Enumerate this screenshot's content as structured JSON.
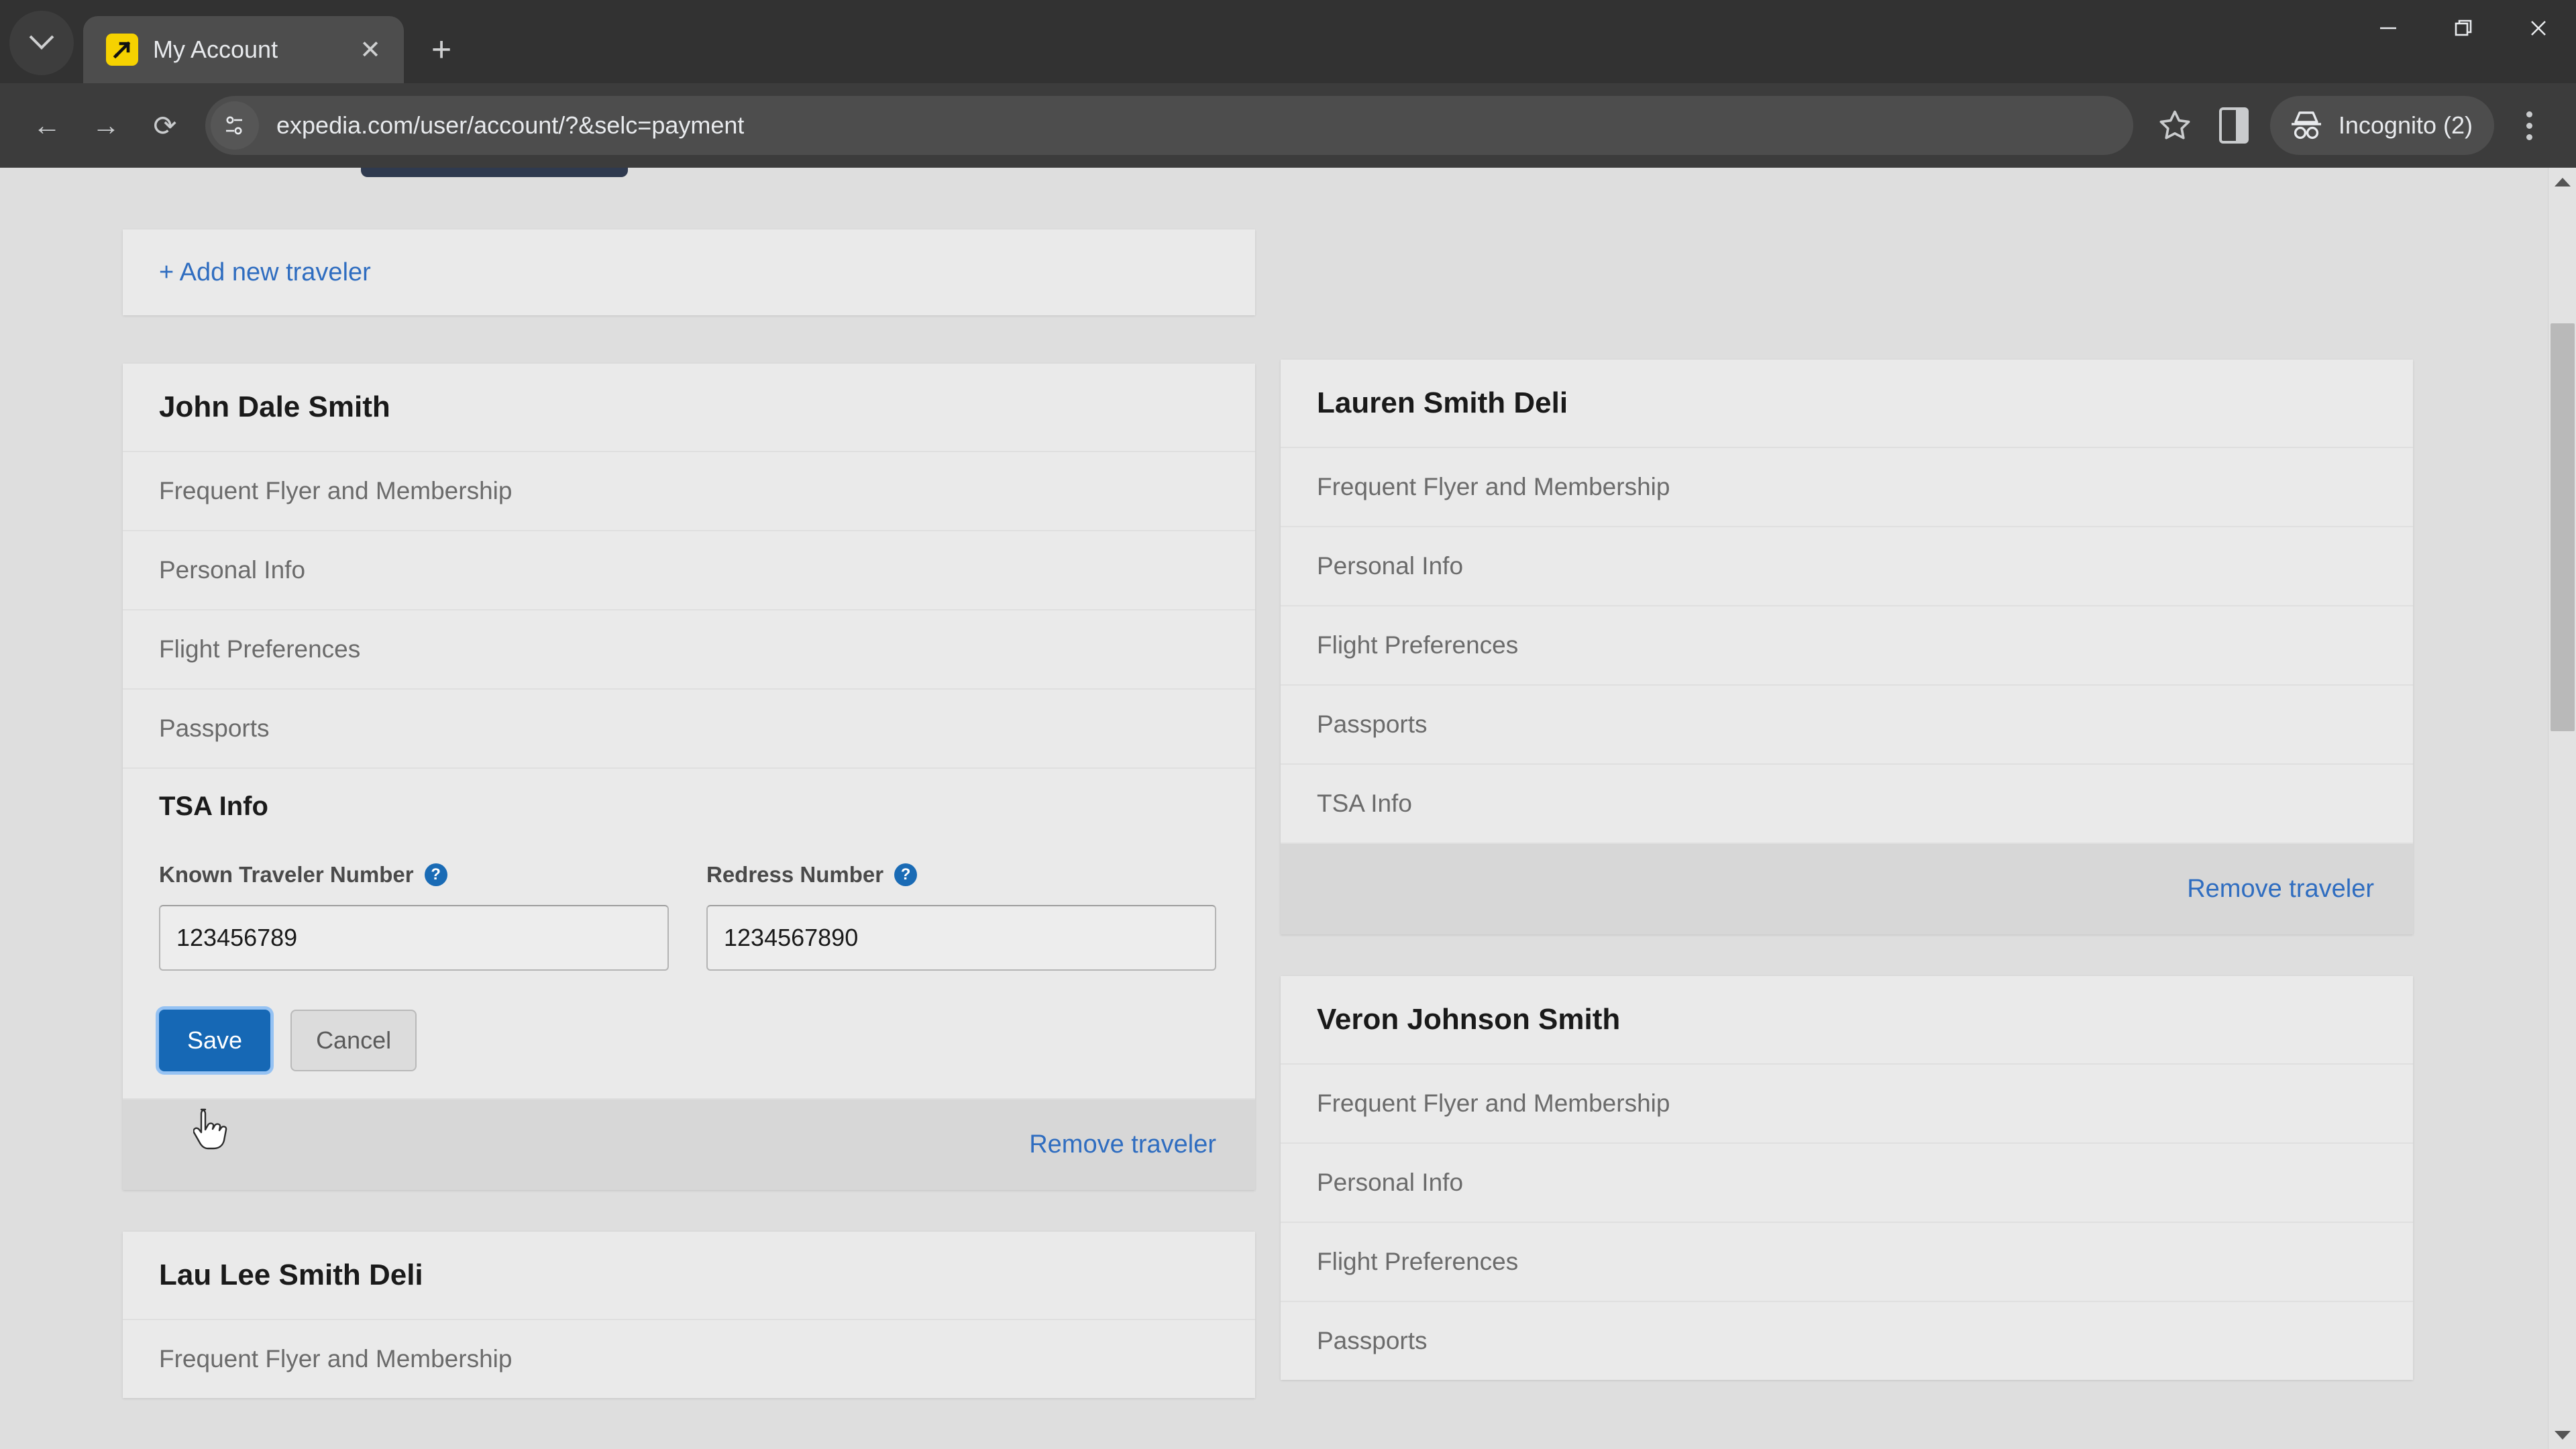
{
  "browser": {
    "tab_search_icon": "chevron-down-icon",
    "tab": {
      "title": "My Account",
      "favicon": "expedia-favicon",
      "close_label": "✕"
    },
    "new_tab_label": "+",
    "window_controls": {
      "minimize": "—",
      "restore": "restore",
      "close": "✕"
    },
    "nav": {
      "back": "←",
      "forward": "→",
      "reload": "⟳"
    },
    "omnibox": {
      "site_info_icon": "site-settings-icon",
      "url": "expedia.com/user/account/?&selc=payment"
    },
    "bookmark_icon": "star-icon",
    "side_panel_icon": "side-panel-icon",
    "incognito": {
      "icon": "incognito-icon",
      "label": "Incognito (2)"
    },
    "menu_icon": "kebab-menu-icon"
  },
  "page": {
    "add_traveler_label": "+ Add new traveler",
    "remove_traveler_label": "Remove traveler",
    "section_rows": [
      "Frequent Flyer and Membership",
      "Personal Info",
      "Flight Preferences",
      "Passports",
      "TSA Info"
    ],
    "left_column": {
      "traveler_1": {
        "name": "John Dale Smith",
        "rows": [
          "Frequent Flyer and Membership",
          "Personal Info",
          "Flight Preferences",
          "Passports"
        ],
        "tsa": {
          "title": "TSA Info",
          "known_traveler": {
            "label": "Known Traveler Number",
            "help_icon": "?",
            "value": "123456789",
            "placeholder": ""
          },
          "redress": {
            "label": "Redress Number",
            "help_icon": "?",
            "value": "1234567890",
            "placeholder": ""
          },
          "save_label": "Save",
          "cancel_label": "Cancel"
        },
        "remove_label": "Remove traveler"
      },
      "traveler_2": {
        "name": "Lau Lee Smith Deli"
      }
    },
    "right_column": {
      "traveler_1": {
        "name": "Lauren Smith Deli",
        "rows": [
          "Frequent Flyer and Membership",
          "Personal Info",
          "Flight Preferences",
          "Passports",
          "TSA Info"
        ],
        "remove_label": "Remove traveler"
      },
      "traveler_2": {
        "name": "Veron Johnson Smith",
        "rows": [
          "Frequent Flyer and Membership",
          "Personal Info",
          "Flight Preferences",
          "Passports"
        ]
      }
    }
  },
  "colors": {
    "accent_blue": "#1668b5",
    "link_blue": "#2f6dc0",
    "page_bg": "#dedede",
    "card_bg": "#eaeaea",
    "footer_bg": "#d7d7d7",
    "chrome_bg": "#3c3c3c"
  }
}
